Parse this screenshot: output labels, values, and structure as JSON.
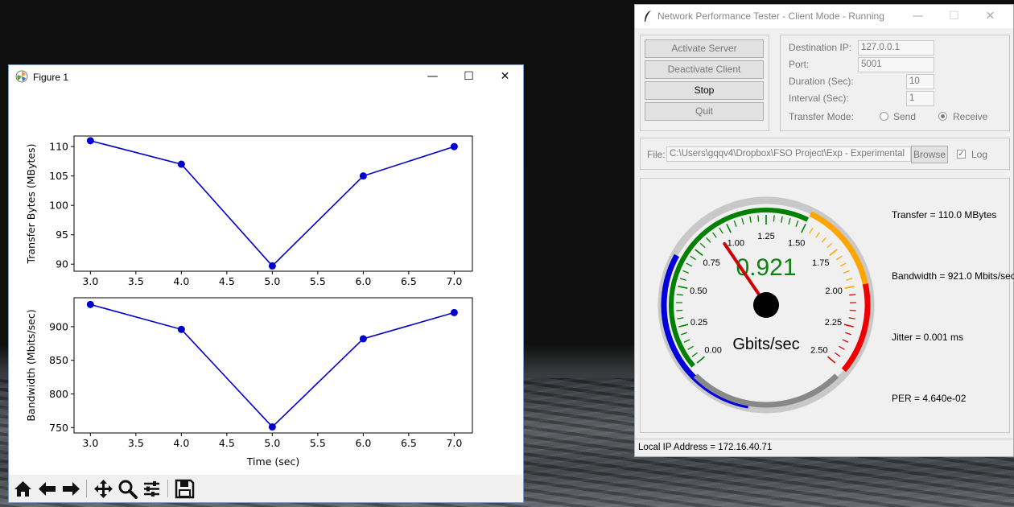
{
  "figure_window": {
    "title": "Figure 1",
    "controls": {
      "minimize": "—",
      "maximize": "☐",
      "close": "✕"
    },
    "toolbar": [
      "home-icon",
      "back-icon",
      "forward-icon",
      "pan-icon",
      "zoom-icon",
      "configure-icon",
      "save-icon"
    ]
  },
  "chart_data": [
    {
      "type": "line",
      "x": [
        3.0,
        4.0,
        5.0,
        6.0,
        7.0
      ],
      "series": [
        {
          "values": [
            111,
            107,
            89.7,
            105,
            110
          ],
          "color": "#0000cc"
        }
      ],
      "xlabel": "",
      "ylabel": "Transfer Bytes (MBytes)",
      "xticks": [
        "3.0",
        "3.5",
        "4.0",
        "4.5",
        "5.0",
        "5.5",
        "6.0",
        "6.5",
        "7.0"
      ],
      "yticks": [
        "90",
        "95",
        "100",
        "105",
        "110"
      ],
      "xlim": [
        2.82,
        7.2
      ],
      "ylim": [
        88.8,
        111.8
      ],
      "grid": false
    },
    {
      "type": "line",
      "x": [
        3.0,
        4.0,
        5.0,
        6.0,
        7.0
      ],
      "series": [
        {
          "values": [
            933,
            896,
            751,
            882,
            921
          ],
          "color": "#0000cc"
        }
      ],
      "xlabel": "Time (sec)",
      "ylabel": "Bandwidth (Mbits/sec)",
      "xticks": [
        "3.0",
        "3.5",
        "4.0",
        "4.5",
        "5.0",
        "5.5",
        "6.0",
        "6.5",
        "7.0"
      ],
      "yticks": [
        "750",
        "800",
        "850",
        "900"
      ],
      "xlim": [
        2.82,
        7.2
      ],
      "ylim": [
        742,
        943
      ],
      "grid": false
    }
  ],
  "tester": {
    "title": "Network Performance Tester - Client Mode - Running",
    "controls": {
      "minimize": "—",
      "maximize": "☐",
      "close": "✕"
    },
    "buttons": {
      "activate_server": "Activate Server",
      "deactivate_client": "Deactivate Client",
      "stop": "Stop",
      "quit": "Quit"
    },
    "labels": {
      "destination_ip": "Destination IP:",
      "port": "Port:",
      "duration": "Duration (Sec):",
      "interval": "Interval (Sec):",
      "transfer_mode": "Transfer Mode:",
      "send": "Send",
      "receive": "Receive",
      "file": "File:",
      "browse": "Browse",
      "log": "Log"
    },
    "values": {
      "destination_ip": "127.0.0.1",
      "port": "5001",
      "duration": "10",
      "interval": "1",
      "file_path": "C:\\Users\\gqqv4\\Dropbox\\FSO Project\\Exp - Experimental",
      "transfer_mode": "Receive",
      "log_checked": true
    },
    "gauge": {
      "value": 0.921,
      "value_text": "0.921",
      "unit": "Gbits/sec",
      "min": 0,
      "max": 2.5,
      "tick_labels": [
        "0.00",
        "0.25",
        "0.50",
        "0.75",
        "1.00",
        "1.25",
        "1.50",
        "1.75",
        "2.00",
        "2.25",
        "2.50"
      ],
      "colors": {
        "blue": "#0000dd",
        "green": "#008000",
        "orange": "#ffa500",
        "red": "#ee0000",
        "grey": "#888888",
        "needle": "#cc0000",
        "value_text": "#108010"
      }
    },
    "stats": {
      "transfer": "Transfer = 110.0 MBytes",
      "bandwidth": "Bandwidth = 921.0 Mbits/sec",
      "jitter": "Jitter = 0.001 ms",
      "per": "PER = 4.640e-02"
    },
    "status": "Local IP Address = 172.16.40.71"
  }
}
